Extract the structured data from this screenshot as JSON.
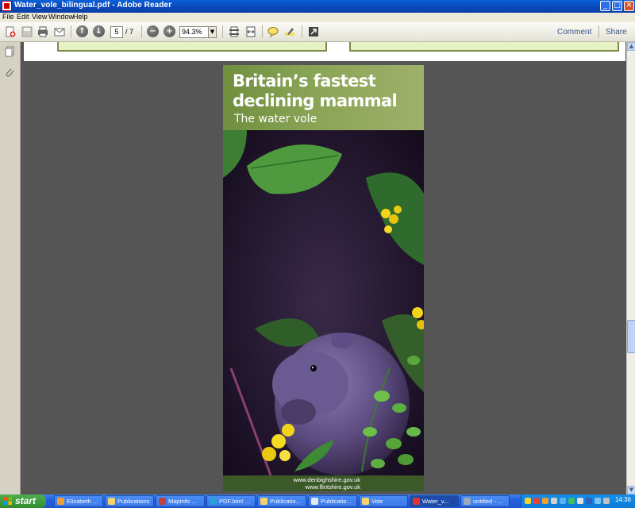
{
  "window": {
    "title": "Water_vole_bilingual.pdf - Adobe Reader"
  },
  "menu": [
    "File",
    "Edit",
    "View",
    "Window",
    "Help"
  ],
  "toolbar": {
    "current_page": "5",
    "total_pages": "/ 7",
    "zoom": "94.3%",
    "comment_label": "Comment",
    "share_label": "Share"
  },
  "document": {
    "title_line1": "Britain’s fastest",
    "title_line2": "declining mammal",
    "subtitle": "The water vole",
    "url1": "www.denbighshire.gov.uk",
    "url2": "www.flintshire.gov.uk"
  },
  "taskbar": {
    "start_label": "start",
    "tasks": [
      "Elizabeth ...",
      "Publications",
      "MapInfo ...",
      "PDFJoin! ...",
      "Publicatio...",
      "Publicatio...",
      "Vole",
      "Water_v...",
      "untitled - ..."
    ],
    "clock": "14:36"
  },
  "colors": {
    "banner_green": "#8aa456",
    "title_bar_blue": "#0a5fd8",
    "taskbar_blue": "#245edb"
  }
}
